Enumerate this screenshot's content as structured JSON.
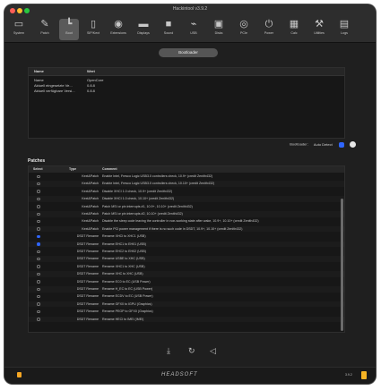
{
  "window": {
    "title": "Hackintool v3.9.2"
  },
  "toolbar": {
    "items": [
      {
        "label": "System",
        "icon": "computer-icon"
      },
      {
        "label": "Patch",
        "icon": "brush-icon"
      },
      {
        "label": "Boot",
        "icon": "boot-icon"
      },
      {
        "label": "SIP/Kext",
        "icon": "kext-icon"
      },
      {
        "label": "Extensions",
        "icon": "extensions-icon"
      },
      {
        "label": "Displays",
        "icon": "display-icon"
      },
      {
        "label": "Sound",
        "icon": "sound-icon"
      },
      {
        "label": "USB",
        "icon": "usb-icon"
      },
      {
        "label": "Disks",
        "icon": "disk-icon"
      },
      {
        "label": "PCIe",
        "icon": "pcie-icon"
      },
      {
        "label": "Power",
        "icon": "power-icon"
      },
      {
        "label": "Calc",
        "icon": "calculator-icon"
      },
      {
        "label": "Utilities",
        "icon": "wrench-icon"
      },
      {
        "label": "Logs",
        "icon": "log-icon"
      }
    ],
    "active_index": 2
  },
  "bootloader_button": "Bootloader",
  "info_table": {
    "headers": [
      "Name",
      "Wert"
    ],
    "rows": [
      [
        "Name",
        "OpenCore"
      ],
      [
        "Aktuell eingesetzte Ve...",
        "0.8.8"
      ],
      [
        "Aktuell verfügbare Versi...",
        "0.8.8"
      ]
    ]
  },
  "bootloader_select": {
    "label": "Bootloader:",
    "value": "Auto Detect"
  },
  "patches": {
    "title": "Patches",
    "headers": [
      "Select",
      "Type",
      "Comment"
    ],
    "rows": [
      {
        "selected": false,
        "type": "Kext&Patch",
        "comment": "Enable Intel, Fresco Logic USB3.0 controllers check, 10.9+ (credit Zenith432)"
      },
      {
        "selected": false,
        "type": "Kext&Patch",
        "comment": "Enable Intel, Fresco Logic USB3.0 controllers check, 10.10+ (credit Zenith432)"
      },
      {
        "selected": false,
        "type": "Kext&Patch",
        "comment": "Disable XHCI 1.0 check, 10.9+ (credit Zenith432)"
      },
      {
        "selected": false,
        "type": "Kext&Patch",
        "comment": "Disable XHCI 1.0 check, 10.10+ (credit Zenith432)"
      },
      {
        "selected": false,
        "type": "Kext&Patch",
        "comment": "Patch MSI or pin interrupts #1, 10.9+, 10.10+ (credit Zenith432)"
      },
      {
        "selected": false,
        "type": "Kext&Patch",
        "comment": "Patch MSI or pin interrupts #2, 10.10+ (credit Zenith432)"
      },
      {
        "selected": false,
        "type": "Kext&Patch",
        "comment": "Disable the sleep code leaving the controller in non-working state after wake, 10.9+, 10.10+ (credit Zenith432)"
      },
      {
        "selected": false,
        "type": "Kext&Patch",
        "comment": "Enable PCI power management if there is no such code in DSDT, 10.9+, 10.10+ (credit Zenith432)"
      },
      {
        "selected": true,
        "type": "DSDT Rename",
        "comment": "Rename XHCI to XHC1 (USB)"
      },
      {
        "selected": true,
        "type": "DSDT Rename",
        "comment": "Rename EHC1 to EH01 (USB)"
      },
      {
        "selected": false,
        "type": "DSDT Rename",
        "comment": "Rename EHC2 to EH02 (USB)"
      },
      {
        "selected": false,
        "type": "DSDT Rename",
        "comment": "Rename USBE to XHC (USB)"
      },
      {
        "selected": false,
        "type": "DSDT Rename",
        "comment": "Rename XHC1 to XHC (USB)"
      },
      {
        "selected": false,
        "type": "DSDT Rename",
        "comment": "Rename XHC to XHC (USB)"
      },
      {
        "selected": false,
        "type": "DSDT Rename",
        "comment": "Rename EC0 to EC (USB Power)"
      },
      {
        "selected": false,
        "type": "DSDT Rename",
        "comment": "Rename H_EC to EC (USB Power)"
      },
      {
        "selected": false,
        "type": "DSDT Rename",
        "comment": "Rename ECDV to EC (USB Power)"
      },
      {
        "selected": false,
        "type": "DSDT Rename",
        "comment": "Rename GFX0 to IGPU (Graphics)"
      },
      {
        "selected": false,
        "type": "DSDT Rename",
        "comment": "Rename PEGP to GFX0 (Graphics)"
      },
      {
        "selected": false,
        "type": "DSDT Rename",
        "comment": "Rename HECI to IMEI (IMEI)"
      }
    ]
  },
  "footer": {
    "brand": "HEADSOFT",
    "version": "3.9.2"
  },
  "colors": {
    "accent": "#2f66ff",
    "close": "#ff5f57",
    "minimize": "#febc2e",
    "zoom": "#28c840"
  }
}
